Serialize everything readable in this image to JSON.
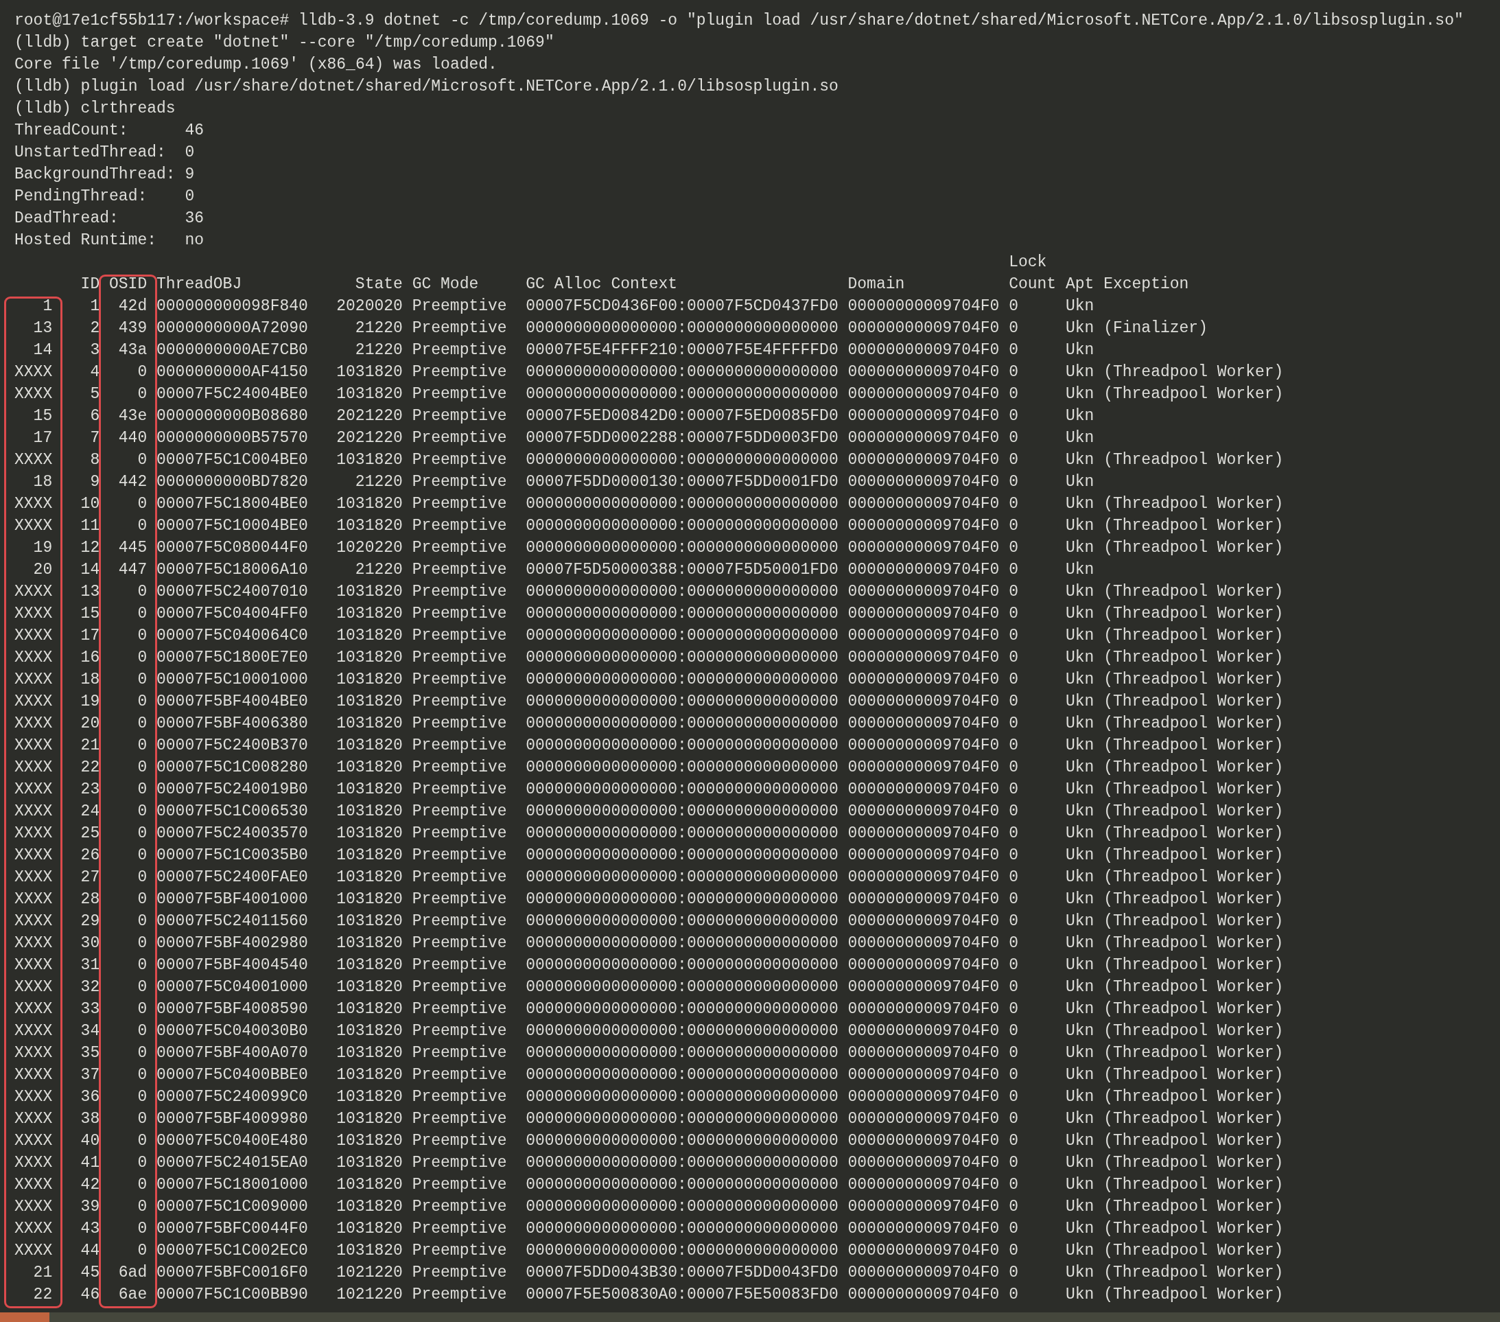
{
  "terminal": {
    "lines": [
      "root@17e1cf55b117:/workspace# lldb-3.9 dotnet -c /tmp/coredump.1069 -o \"plugin load /usr/share/dotnet/shared/Microsoft.NETCore.App/2.1.0/libsosplugin.so\"",
      "(lldb) target create \"dotnet\" --core \"/tmp/coredump.1069\"",
      "Core file '/tmp/coredump.1069' (x86_64) was loaded.",
      "(lldb) plugin load /usr/share/dotnet/shared/Microsoft.NETCore.App/2.1.0/libsosplugin.so",
      "(lldb) clrthreads"
    ],
    "stats": [
      {
        "label": "ThreadCount:",
        "value": "46"
      },
      {
        "label": "UnstartedThread:",
        "value": "0"
      },
      {
        "label": "BackgroundThread:",
        "value": "9"
      },
      {
        "label": "PendingThread:",
        "value": "0"
      },
      {
        "label": "DeadThread:",
        "value": "36"
      },
      {
        "label": "Hosted Runtime:",
        "value": "no"
      }
    ],
    "table": {
      "columns": [
        {
          "highlighted": true
        },
        {
          "label": "ID",
          "highlighted": false
        },
        {
          "label": "OSID",
          "highlighted": true
        },
        {
          "label": "ThreadOBJ",
          "highlighted": false
        },
        {
          "label": "State",
          "highlighted": false
        },
        {
          "label": "GC Mode",
          "highlighted": false
        },
        {
          "label": "GC Alloc Context",
          "highlighted": false
        },
        {
          "label": "Domain",
          "highlighted": false
        },
        {
          "label": "Lock Count",
          "highlighted": false
        },
        {
          "label": "Apt",
          "highlighted": false
        },
        {
          "label": "Exception",
          "highlighted": false
        }
      ],
      "rows": [
        [
          "1",
          "1",
          "42d",
          "000000000098F840",
          "2020020",
          "Preemptive",
          "00007F5CD0436F00:00007F5CD0437FD0",
          "00000000009704F0",
          "0",
          "Ukn"
        ],
        [
          "13",
          "2",
          "439",
          "0000000000A72090",
          "21220",
          "Preemptive",
          "0000000000000000:0000000000000000",
          "00000000009704F0",
          "0",
          "Ukn",
          "(Finalizer)"
        ],
        [
          "14",
          "3",
          "43a",
          "0000000000AE7CB0",
          "21220",
          "Preemptive",
          "00007F5E4FFFF210:00007F5E4FFFFFD0",
          "00000000009704F0",
          "0",
          "Ukn"
        ],
        [
          "XXXX",
          "4",
          "0",
          "0000000000AF4150",
          "1031820",
          "Preemptive",
          "0000000000000000:0000000000000000",
          "00000000009704F0",
          "0",
          "Ukn",
          "(Threadpool Worker)"
        ],
        [
          "XXXX",
          "5",
          "0",
          "00007F5C24004BE0",
          "1031820",
          "Preemptive",
          "0000000000000000:0000000000000000",
          "00000000009704F0",
          "0",
          "Ukn",
          "(Threadpool Worker)"
        ],
        [
          "15",
          "6",
          "43e",
          "0000000000B08680",
          "2021220",
          "Preemptive",
          "00007F5ED00842D0:00007F5ED0085FD0",
          "00000000009704F0",
          "0",
          "Ukn"
        ],
        [
          "17",
          "7",
          "440",
          "0000000000B57570",
          "2021220",
          "Preemptive",
          "00007F5DD0002288:00007F5DD0003FD0",
          "00000000009704F0",
          "0",
          "Ukn"
        ],
        [
          "XXXX",
          "8",
          "0",
          "00007F5C1C004BE0",
          "1031820",
          "Preemptive",
          "0000000000000000:0000000000000000",
          "00000000009704F0",
          "0",
          "Ukn",
          "(Threadpool Worker)"
        ],
        [
          "18",
          "9",
          "442",
          "0000000000BD7820",
          "21220",
          "Preemptive",
          "00007F5DD0000130:00007F5DD0001FD0",
          "00000000009704F0",
          "0",
          "Ukn"
        ],
        [
          "XXXX",
          "10",
          "0",
          "00007F5C18004BE0",
          "1031820",
          "Preemptive",
          "0000000000000000:0000000000000000",
          "00000000009704F0",
          "0",
          "Ukn",
          "(Threadpool Worker)"
        ],
        [
          "XXXX",
          "11",
          "0",
          "00007F5C10004BE0",
          "1031820",
          "Preemptive",
          "0000000000000000:0000000000000000",
          "00000000009704F0",
          "0",
          "Ukn",
          "(Threadpool Worker)"
        ],
        [
          "19",
          "12",
          "445",
          "00007F5C080044F0",
          "1020220",
          "Preemptive",
          "0000000000000000:0000000000000000",
          "00000000009704F0",
          "0",
          "Ukn",
          "(Threadpool Worker)"
        ],
        [
          "20",
          "14",
          "447",
          "00007F5C18006A10",
          "21220",
          "Preemptive",
          "00007F5D50000388:00007F5D50001FD0",
          "00000000009704F0",
          "0",
          "Ukn"
        ],
        [
          "XXXX",
          "13",
          "0",
          "00007F5C24007010",
          "1031820",
          "Preemptive",
          "0000000000000000:0000000000000000",
          "00000000009704F0",
          "0",
          "Ukn",
          "(Threadpool Worker)"
        ],
        [
          "XXXX",
          "15",
          "0",
          "00007F5C04004FF0",
          "1031820",
          "Preemptive",
          "0000000000000000:0000000000000000",
          "00000000009704F0",
          "0",
          "Ukn",
          "(Threadpool Worker)"
        ],
        [
          "XXXX",
          "17",
          "0",
          "00007F5C040064C0",
          "1031820",
          "Preemptive",
          "0000000000000000:0000000000000000",
          "00000000009704F0",
          "0",
          "Ukn",
          "(Threadpool Worker)"
        ],
        [
          "XXXX",
          "16",
          "0",
          "00007F5C1800E7E0",
          "1031820",
          "Preemptive",
          "0000000000000000:0000000000000000",
          "00000000009704F0",
          "0",
          "Ukn",
          "(Threadpool Worker)"
        ],
        [
          "XXXX",
          "18",
          "0",
          "00007F5C10001000",
          "1031820",
          "Preemptive",
          "0000000000000000:0000000000000000",
          "00000000009704F0",
          "0",
          "Ukn",
          "(Threadpool Worker)"
        ],
        [
          "XXXX",
          "19",
          "0",
          "00007F5BF4004BE0",
          "1031820",
          "Preemptive",
          "0000000000000000:0000000000000000",
          "00000000009704F0",
          "0",
          "Ukn",
          "(Threadpool Worker)"
        ],
        [
          "XXXX",
          "20",
          "0",
          "00007F5BF4006380",
          "1031820",
          "Preemptive",
          "0000000000000000:0000000000000000",
          "00000000009704F0",
          "0",
          "Ukn",
          "(Threadpool Worker)"
        ],
        [
          "XXXX",
          "21",
          "0",
          "00007F5C2400B370",
          "1031820",
          "Preemptive",
          "0000000000000000:0000000000000000",
          "00000000009704F0",
          "0",
          "Ukn",
          "(Threadpool Worker)"
        ],
        [
          "XXXX",
          "22",
          "0",
          "00007F5C1C008280",
          "1031820",
          "Preemptive",
          "0000000000000000:0000000000000000",
          "00000000009704F0",
          "0",
          "Ukn",
          "(Threadpool Worker)"
        ],
        [
          "XXXX",
          "23",
          "0",
          "00007F5C240019B0",
          "1031820",
          "Preemptive",
          "0000000000000000:0000000000000000",
          "00000000009704F0",
          "0",
          "Ukn",
          "(Threadpool Worker)"
        ],
        [
          "XXXX",
          "24",
          "0",
          "00007F5C1C006530",
          "1031820",
          "Preemptive",
          "0000000000000000:0000000000000000",
          "00000000009704F0",
          "0",
          "Ukn",
          "(Threadpool Worker)"
        ],
        [
          "XXXX",
          "25",
          "0",
          "00007F5C24003570",
          "1031820",
          "Preemptive",
          "0000000000000000:0000000000000000",
          "00000000009704F0",
          "0",
          "Ukn",
          "(Threadpool Worker)"
        ],
        [
          "XXXX",
          "26",
          "0",
          "00007F5C1C0035B0",
          "1031820",
          "Preemptive",
          "0000000000000000:0000000000000000",
          "00000000009704F0",
          "0",
          "Ukn",
          "(Threadpool Worker)"
        ],
        [
          "XXXX",
          "27",
          "0",
          "00007F5C2400FAE0",
          "1031820",
          "Preemptive",
          "0000000000000000:0000000000000000",
          "00000000009704F0",
          "0",
          "Ukn",
          "(Threadpool Worker)"
        ],
        [
          "XXXX",
          "28",
          "0",
          "00007F5BF4001000",
          "1031820",
          "Preemptive",
          "0000000000000000:0000000000000000",
          "00000000009704F0",
          "0",
          "Ukn",
          "(Threadpool Worker)"
        ],
        [
          "XXXX",
          "29",
          "0",
          "00007F5C24011560",
          "1031820",
          "Preemptive",
          "0000000000000000:0000000000000000",
          "00000000009704F0",
          "0",
          "Ukn",
          "(Threadpool Worker)"
        ],
        [
          "XXXX",
          "30",
          "0",
          "00007F5BF4002980",
          "1031820",
          "Preemptive",
          "0000000000000000:0000000000000000",
          "00000000009704F0",
          "0",
          "Ukn",
          "(Threadpool Worker)"
        ],
        [
          "XXXX",
          "31",
          "0",
          "00007F5BF4004540",
          "1031820",
          "Preemptive",
          "0000000000000000:0000000000000000",
          "00000000009704F0",
          "0",
          "Ukn",
          "(Threadpool Worker)"
        ],
        [
          "XXXX",
          "32",
          "0",
          "00007F5C04001000",
          "1031820",
          "Preemptive",
          "0000000000000000:0000000000000000",
          "00000000009704F0",
          "0",
          "Ukn",
          "(Threadpool Worker)"
        ],
        [
          "XXXX",
          "33",
          "0",
          "00007F5BF4008590",
          "1031820",
          "Preemptive",
          "0000000000000000:0000000000000000",
          "00000000009704F0",
          "0",
          "Ukn",
          "(Threadpool Worker)"
        ],
        [
          "XXXX",
          "34",
          "0",
          "00007F5C040030B0",
          "1031820",
          "Preemptive",
          "0000000000000000:0000000000000000",
          "00000000009704F0",
          "0",
          "Ukn",
          "(Threadpool Worker)"
        ],
        [
          "XXXX",
          "35",
          "0",
          "00007F5BF400A070",
          "1031820",
          "Preemptive",
          "0000000000000000:0000000000000000",
          "00000000009704F0",
          "0",
          "Ukn",
          "(Threadpool Worker)"
        ],
        [
          "XXXX",
          "37",
          "0",
          "00007F5C0400BBE0",
          "1031820",
          "Preemptive",
          "0000000000000000:0000000000000000",
          "00000000009704F0",
          "0",
          "Ukn",
          "(Threadpool Worker)"
        ],
        [
          "XXXX",
          "36",
          "0",
          "00007F5C240099C0",
          "1031820",
          "Preemptive",
          "0000000000000000:0000000000000000",
          "00000000009704F0",
          "0",
          "Ukn",
          "(Threadpool Worker)"
        ],
        [
          "XXXX",
          "38",
          "0",
          "00007F5BF4009980",
          "1031820",
          "Preemptive",
          "0000000000000000:0000000000000000",
          "00000000009704F0",
          "0",
          "Ukn",
          "(Threadpool Worker)"
        ],
        [
          "XXXX",
          "40",
          "0",
          "00007F5C0400E480",
          "1031820",
          "Preemptive",
          "0000000000000000:0000000000000000",
          "00000000009704F0",
          "0",
          "Ukn",
          "(Threadpool Worker)"
        ],
        [
          "XXXX",
          "41",
          "0",
          "00007F5C24015EA0",
          "1031820",
          "Preemptive",
          "0000000000000000:0000000000000000",
          "00000000009704F0",
          "0",
          "Ukn",
          "(Threadpool Worker)"
        ],
        [
          "XXXX",
          "42",
          "0",
          "00007F5C18001000",
          "1031820",
          "Preemptive",
          "0000000000000000:0000000000000000",
          "00000000009704F0",
          "0",
          "Ukn",
          "(Threadpool Worker)"
        ],
        [
          "XXXX",
          "39",
          "0",
          "00007F5C1C009000",
          "1031820",
          "Preemptive",
          "0000000000000000:0000000000000000",
          "00000000009704F0",
          "0",
          "Ukn",
          "(Threadpool Worker)"
        ],
        [
          "XXXX",
          "43",
          "0",
          "00007F5BFC0044F0",
          "1031820",
          "Preemptive",
          "0000000000000000:0000000000000000",
          "00000000009704F0",
          "0",
          "Ukn",
          "(Threadpool Worker)"
        ],
        [
          "XXXX",
          "44",
          "0",
          "00007F5C1C002EC0",
          "1031820",
          "Preemptive",
          "0000000000000000:0000000000000000",
          "00000000009704F0",
          "0",
          "Ukn",
          "(Threadpool Worker)"
        ],
        [
          "21",
          "45",
          "6ad",
          "00007F5BFC0016F0",
          "1021220",
          "Preemptive",
          "00007F5DD0043B30:00007F5DD0043FD0",
          "00000000009704F0",
          "0",
          "Ukn",
          "(Threadpool Worker)"
        ],
        [
          "22",
          "46",
          "6ae",
          "00007F5C1C00BB90",
          "1021220",
          "Preemptive",
          "00007F5E500830A0:00007F5E50083FD0",
          "00000000009704F0",
          "0",
          "Ukn",
          "(Threadpool Worker)"
        ]
      ]
    }
  }
}
